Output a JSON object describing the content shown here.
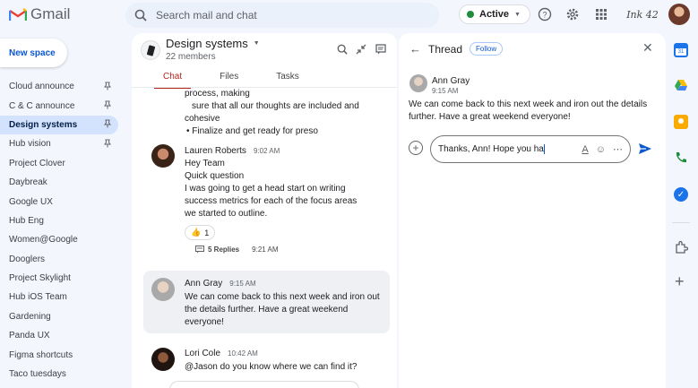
{
  "app": {
    "name": "Gmail"
  },
  "search": {
    "placeholder": "Search mail and chat"
  },
  "status": {
    "label": "Active"
  },
  "account": {
    "badge_text": "Ink 42"
  },
  "sidebar": {
    "new_space_label": "New space",
    "items": [
      {
        "label": "Cloud announce",
        "pinned": true
      },
      {
        "label": "C & C announce",
        "pinned": true
      },
      {
        "label": "Design systems",
        "pinned": true,
        "active": true
      },
      {
        "label": "Hub vision",
        "pinned": true
      },
      {
        "label": "Project Clover"
      },
      {
        "label": "Daybreak"
      },
      {
        "label": "Google UX"
      },
      {
        "label": "Hub Eng"
      },
      {
        "label": "Women@Google"
      },
      {
        "label": "Dooglers"
      },
      {
        "label": "Project Skylight"
      },
      {
        "label": "Hub iOS Team"
      },
      {
        "label": "Gardening"
      },
      {
        "label": "Panda UX"
      },
      {
        "label": "Figma shortcuts"
      },
      {
        "label": "Taco tuesdays"
      }
    ]
  },
  "space": {
    "title": "Design systems",
    "members": "22 members",
    "tabs": [
      {
        "label": "Chat",
        "active": true
      },
      {
        "label": "Files"
      },
      {
        "label": "Tasks"
      }
    ]
  },
  "messages": {
    "partial": {
      "line1": "process, making",
      "line2": "sure that all our thoughts are included and",
      "line3": "cohesive",
      "bullet": "•  Finalize and get ready for preso"
    },
    "lauren": {
      "sender": "Lauren Roberts",
      "time": "9:02 AM",
      "lines": [
        "Hey Team",
        "Quick question",
        "I was going to get a head start on writing",
        "success metrics for each of the focus areas",
        "we started to outline."
      ],
      "reaction": {
        "emoji": "👍",
        "count": "1"
      },
      "replies": "5 Replies",
      "replies_time": "9:21 AM"
    },
    "ann": {
      "sender": "Ann Gray",
      "time": "9:15 AM",
      "lines": [
        "We can come back to this next week and iron out",
        "the details further. Have a great weekend",
        "everyone!"
      ]
    },
    "lori": {
      "sender": "Lori Cole",
      "time": "10:42 AM",
      "text": "@Jason do you know where we can find it?"
    }
  },
  "thread": {
    "title": "Thread",
    "follow_label": "Follow",
    "message": {
      "sender": "Ann Gray",
      "time": "9:15 AM",
      "lines": [
        "We can come back to this next week and iron out the details",
        "further. Have a great weekend everyone!"
      ]
    },
    "compose_value": "Thanks, Ann! Hope you ha"
  },
  "colors": {
    "accent": "#0b57d0",
    "tab_active": "#b3261e",
    "active_green": "#1e8e3e"
  }
}
